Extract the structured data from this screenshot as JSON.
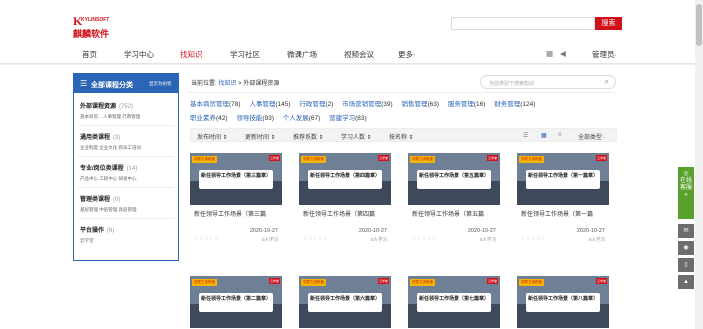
{
  "header": {
    "logo_en": "KYLINSOFT",
    "logo_k": "K",
    "logo_cn": "麒麟软件",
    "search_button": "搜索"
  },
  "nav": {
    "items": [
      "首页",
      "学习中心",
      "找知识",
      "学习社区",
      "微课广场",
      "视频会议",
      "更多·"
    ],
    "user": "管理员·"
  },
  "sidebar": {
    "title": "全部课程分类",
    "toggle": "显示为树状",
    "categories": [
      {
        "name": "外部课程资源",
        "count": "(752)",
        "subs": "基本商贸...  人事管理  行政管理"
      },
      {
        "name": "通用类课程",
        "count": "(3)",
        "subs": "企业制度  企业文化  新员工培训"
      },
      {
        "name": "专业/岗位类课程",
        "count": "(14)",
        "subs": "产品中心  工程中心  研发中心"
      },
      {
        "name": "管理类课程",
        "count": "(0)",
        "subs": "基层管理  中层管理  高层管理"
      },
      {
        "name": "平台操作",
        "count": "(6)",
        "subs": "云学堂"
      }
    ]
  },
  "main": {
    "crumb_prefix": "当前位置:",
    "crumb_link": "找知识",
    "crumb_tail": " > 外部课程资源",
    "search_placeholder": "当前类别下搜索知识",
    "tags_row1": [
      {
        "t": "基本商贸管理",
        "c": "(78)"
      },
      {
        "t": "人事管理",
        "c": "(145)"
      },
      {
        "t": "行政管理",
        "c": "(2)"
      },
      {
        "t": "市场营销管理",
        "c": "(39)"
      },
      {
        "t": "销售管理",
        "c": "(63)"
      },
      {
        "t": "服务管理",
        "c": "(16)"
      },
      {
        "t": "财务管理",
        "c": "(124)"
      }
    ],
    "tags_row2": [
      {
        "t": "职业素养",
        "c": "(42)"
      },
      {
        "t": "领导技能",
        "c": "(93)"
      },
      {
        "t": "个人发展",
        "c": "(67)"
      },
      {
        "t": "营建学习",
        "c": "(83)"
      }
    ],
    "sort": [
      "发布时间 ⇕",
      "更新时间 ⇕",
      "推荐系数 ⇕",
      "学习人数 ⇕",
      "按名称 ⇕"
    ],
    "type_filter": "全部类型 ·"
  },
  "courses": [
    {
      "banner": "新任领导工作场景（第三篇章）",
      "title": "新任领导工作场景（第三篇",
      "date": "2020-10-27",
      "learners": "0人学习"
    },
    {
      "banner": "新任领导工作场景（第四篇章）",
      "title": "新任领导工作场景（第四篇",
      "date": "2020-10-27",
      "learners": "0人学习"
    },
    {
      "banner": "新任领导工作场景（第五篇章）",
      "title": "新任领导工作场景（第五篇",
      "date": "2020-10-27",
      "learners": "0人学习"
    },
    {
      "banner": "新任领导工作场景（第一篇章）",
      "title": "新任领导工作场景（第一篇",
      "date": "2020-10-27",
      "learners": "0人学习"
    },
    {
      "banner": "新任领导工作场景（第二篇章）",
      "title": "",
      "date": "",
      "learners": ""
    },
    {
      "banner": "新任领导工作场景（第六篇章）",
      "title": "",
      "date": "",
      "learners": ""
    },
    {
      "banner": "新任领导工作场景（第七篇章）",
      "title": "",
      "date": "",
      "learners": ""
    },
    {
      "banner": "新任领导工作场景（第八篇章）",
      "title": "",
      "date": "",
      "learners": ""
    }
  ],
  "thumb_tag": "领导力训练营",
  "thumb_corner": "云学堂",
  "stars": "☆☆☆☆☆",
  "right_bar": {
    "online": "在线客服"
  },
  "colors": {
    "brand_red": "#d0121b",
    "brand_blue": "#2b65b8",
    "online_green": "#5aa02c"
  }
}
